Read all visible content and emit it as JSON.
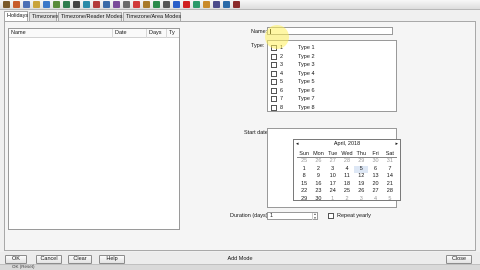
{
  "toolbar": {
    "buttons": [
      {
        "icon": "door-icon",
        "color": "#7a5a2a"
      },
      {
        "icon": "person-icon",
        "color": "#c75b2a"
      },
      {
        "icon": "card-icon",
        "color": "#4a6fb5"
      },
      {
        "icon": "key-icon",
        "color": "#c9a43b"
      },
      {
        "icon": "monitor-icon",
        "color": "#3b78c9"
      },
      {
        "icon": "report-icon",
        "color": "#5a8c3a"
      },
      {
        "icon": "shield-icon",
        "color": "#2e7d4f"
      },
      {
        "icon": "camera-icon",
        "color": "#444444"
      },
      {
        "icon": "network-icon",
        "color": "#2a8aa8"
      },
      {
        "icon": "clock-icon",
        "color": "#b33b3b"
      },
      {
        "icon": "calendar-icon",
        "color": "#3a6aa8"
      },
      {
        "icon": "user-group-icon",
        "color": "#7a4a9a"
      },
      {
        "icon": "settings-icon",
        "color": "#6a6a6a"
      },
      {
        "icon": "alarm-icon",
        "color": "#d13a3a"
      },
      {
        "icon": "lock-icon",
        "color": "#a87a2a"
      },
      {
        "icon": "chart-icon",
        "color": "#2a8a4a"
      },
      {
        "icon": "printer-icon",
        "color": "#555555"
      },
      {
        "icon": "help-icon",
        "color": "#2a5fc9"
      },
      {
        "icon": "stop-icon",
        "color": "#d02020"
      },
      {
        "icon": "refresh-icon",
        "color": "#2a9a6a"
      },
      {
        "icon": "map-icon",
        "color": "#c98a2a"
      },
      {
        "icon": "log-icon",
        "color": "#4a4a8a"
      },
      {
        "icon": "save-icon",
        "color": "#2a6aa8"
      },
      {
        "icon": "exit-icon",
        "color": "#8a2a2a"
      }
    ]
  },
  "tabs": [
    "Holidays",
    "Timezones",
    "Timezone/Reader Modes",
    "Timezone/Area Modes"
  ],
  "active_tab": 0,
  "list": {
    "columns": [
      "Name",
      "Date",
      "Days",
      "Ty"
    ]
  },
  "form": {
    "name_label": "Name:",
    "name_value": "",
    "type_label": "Type:",
    "types": [
      {
        "num": "1",
        "label": "Type 1"
      },
      {
        "num": "2",
        "label": "Type 2"
      },
      {
        "num": "3",
        "label": "Type 3"
      },
      {
        "num": "4",
        "label": "Type 4"
      },
      {
        "num": "5",
        "label": "Type 5"
      },
      {
        "num": "6",
        "label": "Type 6"
      },
      {
        "num": "7",
        "label": "Type 7"
      },
      {
        "num": "8",
        "label": "Type 8"
      }
    ],
    "start_date_label": "Start date:",
    "duration_label": "Duration (days):",
    "duration_value": "1",
    "repeat_label": "Repeat yearly"
  },
  "calendar": {
    "title": "April, 2018",
    "prev": "◂",
    "next": "▸",
    "dow": [
      "Sun",
      "Mon",
      "Tue",
      "Wed",
      "Thu",
      "Fri",
      "Sat"
    ],
    "weeks": [
      [
        "25",
        "26",
        "27",
        "28",
        "29",
        "30",
        "31"
      ],
      [
        "1",
        "2",
        "3",
        "4",
        "5",
        "6",
        "7"
      ],
      [
        "8",
        "9",
        "10",
        "11",
        "12",
        "13",
        "14"
      ],
      [
        "15",
        "16",
        "17",
        "18",
        "19",
        "20",
        "21"
      ],
      [
        "22",
        "23",
        "24",
        "25",
        "26",
        "27",
        "28"
      ],
      [
        "29",
        "30",
        "1",
        "2",
        "3",
        "4",
        "5"
      ]
    ],
    "selected": "5"
  },
  "buttons": {
    "ok": "OK",
    "cancel": "Cancel",
    "clear": "Clear",
    "help": "Help",
    "close": "Close"
  },
  "mode_text": "Add Mode",
  "status_text": "OK (Reset)"
}
